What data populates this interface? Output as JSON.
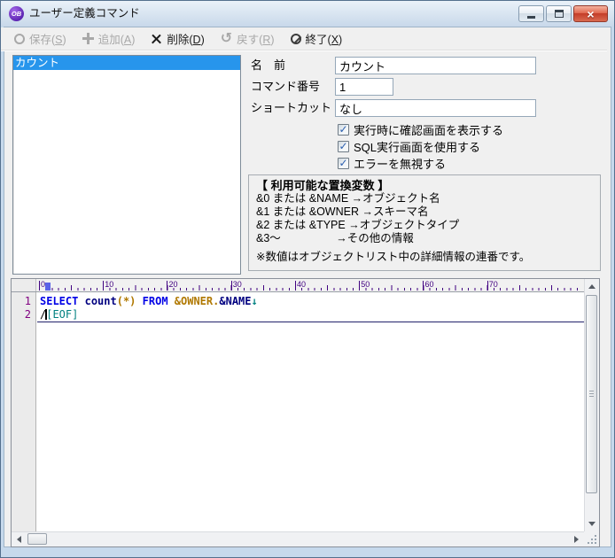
{
  "colors": {
    "frame": "#c6d9ec",
    "selection_bg": "#2795ec",
    "keyword": "#0000e6",
    "identifier": "#000080",
    "symbol": "#b07800",
    "eof_marker": "#008080",
    "line_number": "#800080",
    "ruler_text": "#400080",
    "caret_marker": "#5b63e8"
  },
  "window": {
    "title": "ユーザー定義コマンド",
    "icon_text": "OB"
  },
  "toolbar": {
    "items": [
      {
        "name": "save",
        "icon": "circle",
        "text": "保存",
        "mnemonic": "S",
        "enabled": false
      },
      {
        "name": "add",
        "icon": "plus",
        "text": "追加",
        "mnemonic": "A",
        "enabled": false
      },
      {
        "name": "delete",
        "icon": "cross",
        "text": "削除",
        "mnemonic": "D",
        "enabled": true
      },
      {
        "name": "revert",
        "icon": "undo",
        "text": "戻す",
        "mnemonic": "R",
        "enabled": false
      },
      {
        "name": "exit",
        "icon": "slash-circle",
        "text": "終了",
        "mnemonic": "X",
        "enabled": true
      }
    ]
  },
  "command_list": {
    "items": [
      {
        "label": "カウント",
        "selected": true
      }
    ]
  },
  "form": {
    "fields": [
      {
        "name": "name",
        "label": "名　前",
        "value": "カウント",
        "size": "wide"
      },
      {
        "name": "command-number",
        "label": "コマンド番号",
        "value": "1",
        "size": "narrow"
      },
      {
        "name": "shortcut",
        "label": "ショートカット",
        "value": "なし",
        "size": "wide"
      }
    ],
    "checkboxes": [
      {
        "name": "show-confirm",
        "label": "実行時に確認画面を表示する",
        "checked": true
      },
      {
        "name": "use-sql-screen",
        "label": "SQL実行画面を使用する",
        "checked": true
      },
      {
        "name": "ignore-errors",
        "label": "エラーを無視する",
        "checked": true
      }
    ]
  },
  "variables_box": {
    "title": "【 利用可能な置換変数 】",
    "lines": [
      "&0 または &NAME  →オブジェクト名",
      "&1 または &OWNER →スキーマ名",
      "&2 または &TYPE  →オブジェクトタイプ",
      "&3～　　　　　→その他の情報"
    ],
    "note": "※数値はオブジェクトリスト中の詳細情報の連番です。"
  },
  "editor": {
    "ruler_marks": [
      0,
      10,
      20,
      30,
      40,
      50,
      60,
      70
    ],
    "caret_ruler_column": 1,
    "caret": {
      "line_index": 1,
      "token_index": 1
    },
    "lines": [
      {
        "number": "1",
        "tokens": [
          {
            "text": "SELECT",
            "style": "kw"
          },
          {
            "text": " ",
            "style": "plain"
          },
          {
            "text": "count",
            "style": "ident"
          },
          {
            "text": "(*)",
            "style": "symbol"
          },
          {
            "text": " ",
            "style": "plain"
          },
          {
            "text": "FROM",
            "style": "kw"
          },
          {
            "text": " ",
            "style": "plain"
          },
          {
            "text": "&OWNER",
            "style": "symbol"
          },
          {
            "text": ".",
            "style": "symbol"
          },
          {
            "text": "&NAME",
            "style": "ident"
          },
          {
            "text": "↓",
            "style": "eol"
          }
        ]
      },
      {
        "number": "2",
        "tokens": [
          {
            "text": "/",
            "style": "plain"
          },
          {
            "text": "[EOF]",
            "style": "eof"
          }
        ]
      }
    ]
  }
}
